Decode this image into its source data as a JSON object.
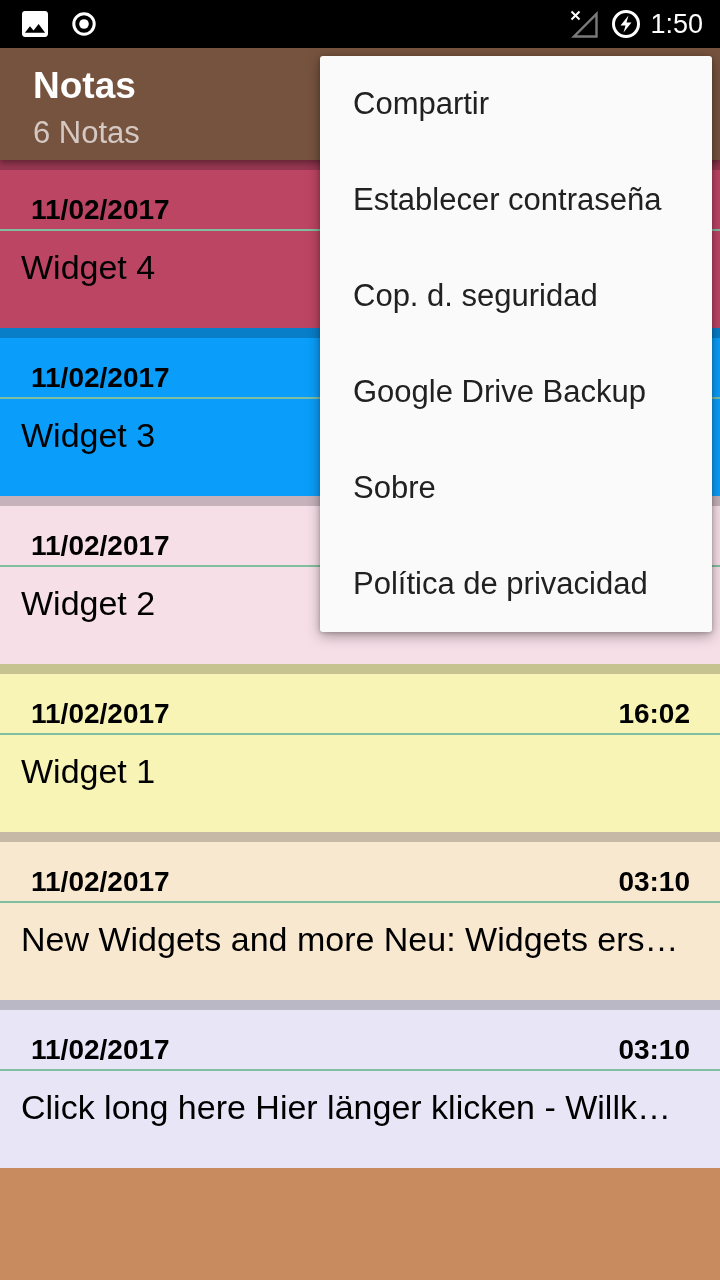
{
  "status_bar": {
    "time": "1:50"
  },
  "app_bar": {
    "title": "Notas",
    "subtitle": "6 Notas"
  },
  "notes": [
    {
      "date": "11/02/2017",
      "title": "Widget 4",
      "color": "#bc4564"
    },
    {
      "date": "11/02/2017",
      "title": "Widget 3",
      "color": "#0a9efa"
    },
    {
      "date": "11/02/2017",
      "title": "Widget 2",
      "color": "#f7dfe8"
    },
    {
      "date": "11/02/2017",
      "time": "16:02",
      "title": "Widget 1",
      "color": "#f8f4b5"
    },
    {
      "date": "11/02/2017",
      "time": "03:10",
      "title": "New Widgets and more Neu: Widgets ers…",
      "color": "#f8e8d0"
    },
    {
      "date": "11/02/2017",
      "time": "03:10",
      "title": "Click long here Hier länger klicken - Willk…",
      "color": "#e8e6f6"
    }
  ],
  "menu": {
    "items": [
      "Compartir",
      "Establecer contraseña",
      "Cop. d. seguridad",
      "Google Drive Backup",
      "Sobre",
      "Política de privacidad"
    ]
  }
}
